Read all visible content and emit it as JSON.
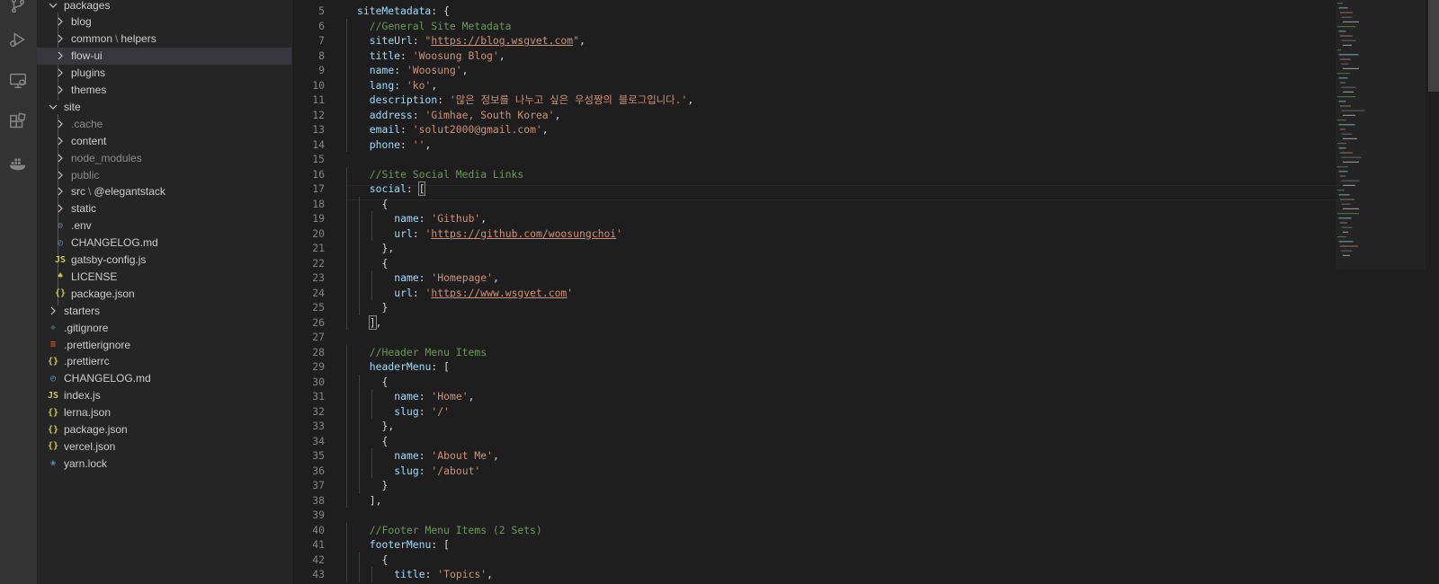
{
  "activity_bar": {
    "icons": [
      "source-control-icon",
      "run-debug-icon",
      "remote-explorer-icon",
      "extensions-icon",
      "docker-icon"
    ]
  },
  "explorer": {
    "rows": [
      {
        "label": "packages",
        "kind": "folder-open",
        "depth": 1
      },
      {
        "label": "blog",
        "kind": "folder",
        "depth": 2
      },
      {
        "label": "common",
        "kind": "folder",
        "depth": 2,
        "suffix": "helpers"
      },
      {
        "label": "flow-ui",
        "kind": "folder",
        "depth": 2,
        "selected": true
      },
      {
        "label": "plugins",
        "kind": "folder",
        "depth": 2
      },
      {
        "label": "themes",
        "kind": "folder",
        "depth": 2
      },
      {
        "label": "site",
        "kind": "folder-open",
        "depth": 1
      },
      {
        "label": ".cache",
        "kind": "folder",
        "depth": 2,
        "dim": true
      },
      {
        "label": "content",
        "kind": "folder",
        "depth": 2
      },
      {
        "label": "node_modules",
        "kind": "folder",
        "depth": 2,
        "dim": true
      },
      {
        "label": "public",
        "kind": "folder",
        "depth": 2,
        "dim": true
      },
      {
        "label": "src",
        "kind": "folder",
        "depth": 2,
        "suffix": "@elegantstack"
      },
      {
        "label": "static",
        "kind": "folder",
        "depth": 2
      },
      {
        "label": ".env",
        "kind": "file",
        "depth": 2,
        "icon": "gear-icon"
      },
      {
        "label": "CHANGELOG.md",
        "kind": "file",
        "depth": 2,
        "icon": "clock-icon"
      },
      {
        "label": "gatsby-config.js",
        "kind": "file",
        "depth": 2,
        "icon": "js-icon"
      },
      {
        "label": "LICENSE",
        "kind": "file",
        "depth": 2,
        "icon": "license-icon"
      },
      {
        "label": "package.json",
        "kind": "file",
        "depth": 2,
        "icon": "json-icon"
      },
      {
        "label": "starters",
        "kind": "folder",
        "depth": 1
      },
      {
        "label": ".gitignore",
        "kind": "file",
        "depth": 1,
        "icon": "git-icon"
      },
      {
        "label": ".prettierignore",
        "kind": "file",
        "depth": 1,
        "icon": "prettier-icon"
      },
      {
        "label": ".prettierrc",
        "kind": "file",
        "depth": 1,
        "icon": "json-icon"
      },
      {
        "label": "CHANGELOG.md",
        "kind": "file",
        "depth": 1,
        "icon": "clock-icon"
      },
      {
        "label": "index.js",
        "kind": "file",
        "depth": 1,
        "icon": "js-icon"
      },
      {
        "label": "lerna.json",
        "kind": "file",
        "depth": 1,
        "icon": "json-icon"
      },
      {
        "label": "package.json",
        "kind": "file",
        "depth": 1,
        "icon": "json-icon"
      },
      {
        "label": "vercel.json",
        "kind": "file",
        "depth": 1,
        "icon": "json-icon"
      },
      {
        "label": "yarn.lock",
        "kind": "file",
        "depth": 1,
        "icon": "yarn-icon"
      }
    ]
  },
  "editor": {
    "lines": [
      {
        "n": "5",
        "tokens": [
          [
            "k",
            "siteMetadata"
          ],
          [
            "p",
            ": {"
          ]
        ],
        "indent": 1
      },
      {
        "n": "6",
        "tokens": [
          [
            "c",
            "//General Site Metadata"
          ]
        ],
        "indent": 2
      },
      {
        "n": "7",
        "tokens": [
          [
            "k",
            "siteUrl"
          ],
          [
            "p",
            ": "
          ],
          [
            "s",
            "\""
          ],
          [
            "u",
            "https://blog.wsgvet.com"
          ],
          [
            "s",
            "\""
          ],
          [
            "p",
            ","
          ]
        ],
        "indent": 2
      },
      {
        "n": "8",
        "tokens": [
          [
            "k",
            "title"
          ],
          [
            "p",
            ": "
          ],
          [
            "s",
            "'Woosung Blog'"
          ],
          [
            "p",
            ","
          ]
        ],
        "indent": 2
      },
      {
        "n": "9",
        "tokens": [
          [
            "k",
            "name"
          ],
          [
            "p",
            ": "
          ],
          [
            "s",
            "'Woosung'"
          ],
          [
            "p",
            ","
          ]
        ],
        "indent": 2
      },
      {
        "n": "10",
        "tokens": [
          [
            "k",
            "lang"
          ],
          [
            "p",
            ": "
          ],
          [
            "s",
            "'ko'"
          ],
          [
            "p",
            ","
          ]
        ],
        "indent": 2
      },
      {
        "n": "11",
        "tokens": [
          [
            "k",
            "description"
          ],
          [
            "p",
            ": "
          ],
          [
            "s",
            "'많은 정보를 나누고 싶은 우성짱의 블로그입니다.'"
          ],
          [
            "p",
            ","
          ]
        ],
        "indent": 2
      },
      {
        "n": "12",
        "tokens": [
          [
            "k",
            "address"
          ],
          [
            "p",
            ": "
          ],
          [
            "s",
            "'Gimhae, South Korea'"
          ],
          [
            "p",
            ","
          ]
        ],
        "indent": 2
      },
      {
        "n": "13",
        "tokens": [
          [
            "k",
            "email"
          ],
          [
            "p",
            ": "
          ],
          [
            "s",
            "'solut2000@gmail.com'"
          ],
          [
            "p",
            ","
          ]
        ],
        "indent": 2
      },
      {
        "n": "14",
        "tokens": [
          [
            "k",
            "phone"
          ],
          [
            "p",
            ": "
          ],
          [
            "s",
            "''"
          ],
          [
            "p",
            ","
          ]
        ],
        "indent": 2
      },
      {
        "n": "15",
        "tokens": [],
        "indent": 0
      },
      {
        "n": "16",
        "tokens": [
          [
            "c",
            "//Site Social Media Links"
          ]
        ],
        "indent": 2
      },
      {
        "n": "17",
        "tokens": [
          [
            "k",
            "social"
          ],
          [
            "p",
            ": "
          ],
          [
            "b",
            "["
          ]
        ],
        "indent": 2
      },
      {
        "n": "18",
        "tokens": [
          [
            "p",
            "{"
          ]
        ],
        "indent": 3
      },
      {
        "n": "19",
        "tokens": [
          [
            "k",
            "name"
          ],
          [
            "p",
            ": "
          ],
          [
            "s",
            "'Github'"
          ],
          [
            "p",
            ","
          ]
        ],
        "indent": 4
      },
      {
        "n": "20",
        "tokens": [
          [
            "k",
            "url"
          ],
          [
            "p",
            ": "
          ],
          [
            "s",
            "'"
          ],
          [
            "u",
            "https://github.com/woosungchoi"
          ],
          [
            "s",
            "'"
          ]
        ],
        "indent": 4
      },
      {
        "n": "21",
        "tokens": [
          [
            "p",
            "},"
          ]
        ],
        "indent": 3
      },
      {
        "n": "22",
        "tokens": [
          [
            "p",
            "{"
          ]
        ],
        "indent": 3
      },
      {
        "n": "23",
        "tokens": [
          [
            "k",
            "name"
          ],
          [
            "p",
            ": "
          ],
          [
            "s",
            "'Homepage'"
          ],
          [
            "p",
            ","
          ]
        ],
        "indent": 4
      },
      {
        "n": "24",
        "tokens": [
          [
            "k",
            "url"
          ],
          [
            "p",
            ": "
          ],
          [
            "s",
            "'"
          ],
          [
            "u",
            "https://www.wsgvet.com"
          ],
          [
            "s",
            "'"
          ]
        ],
        "indent": 4
      },
      {
        "n": "25",
        "tokens": [
          [
            "p",
            "}"
          ]
        ],
        "indent": 3
      },
      {
        "n": "26",
        "tokens": [
          [
            "b",
            "]"
          ],
          [
            "p",
            ","
          ]
        ],
        "indent": 2
      },
      {
        "n": "27",
        "tokens": [],
        "indent": 0
      },
      {
        "n": "28",
        "tokens": [
          [
            "c",
            "//Header Menu Items"
          ]
        ],
        "indent": 2
      },
      {
        "n": "29",
        "tokens": [
          [
            "k",
            "headerMenu"
          ],
          [
            "p",
            ": ["
          ]
        ],
        "indent": 2
      },
      {
        "n": "30",
        "tokens": [
          [
            "p",
            "{"
          ]
        ],
        "indent": 3
      },
      {
        "n": "31",
        "tokens": [
          [
            "k",
            "name"
          ],
          [
            "p",
            ": "
          ],
          [
            "s",
            "'Home'"
          ],
          [
            "p",
            ","
          ]
        ],
        "indent": 4
      },
      {
        "n": "32",
        "tokens": [
          [
            "k",
            "slug"
          ],
          [
            "p",
            ": "
          ],
          [
            "s",
            "'/'"
          ]
        ],
        "indent": 4
      },
      {
        "n": "33",
        "tokens": [
          [
            "p",
            "},"
          ]
        ],
        "indent": 3
      },
      {
        "n": "34",
        "tokens": [
          [
            "p",
            "{"
          ]
        ],
        "indent": 3
      },
      {
        "n": "35",
        "tokens": [
          [
            "k",
            "name"
          ],
          [
            "p",
            ": "
          ],
          [
            "s",
            "'About Me'"
          ],
          [
            "p",
            ","
          ]
        ],
        "indent": 4
      },
      {
        "n": "36",
        "tokens": [
          [
            "k",
            "slug"
          ],
          [
            "p",
            ": "
          ],
          [
            "s",
            "'/about'"
          ]
        ],
        "indent": 4
      },
      {
        "n": "37",
        "tokens": [
          [
            "p",
            "}"
          ]
        ],
        "indent": 3
      },
      {
        "n": "38",
        "tokens": [
          [
            "p",
            "],"
          ]
        ],
        "indent": 2
      },
      {
        "n": "39",
        "tokens": [],
        "indent": 0
      },
      {
        "n": "40",
        "tokens": [
          [
            "c",
            "//Footer Menu Items (2 Sets)"
          ]
        ],
        "indent": 2
      },
      {
        "n": "41",
        "tokens": [
          [
            "k",
            "footerMenu"
          ],
          [
            "p",
            ": ["
          ]
        ],
        "indent": 2
      },
      {
        "n": "42",
        "tokens": [
          [
            "p",
            "{"
          ]
        ],
        "indent": 3
      },
      {
        "n": "43",
        "tokens": [
          [
            "k",
            "title"
          ],
          [
            "p",
            ": "
          ],
          [
            "s",
            "'Topics'"
          ],
          [
            "p",
            ","
          ]
        ],
        "indent": 4
      }
    ]
  },
  "colors": {
    "folder_icon": "#c5c5c5",
    "js_icon": "#cbcb41",
    "json_icon": "#cbcb41",
    "clock_icon": "#519aba",
    "gear_icon": "#6d8086",
    "license_icon": "#cbcb41",
    "git_icon": "#41535b",
    "prettier_icon": "#e34c26",
    "yarn_icon": "#519aba"
  }
}
